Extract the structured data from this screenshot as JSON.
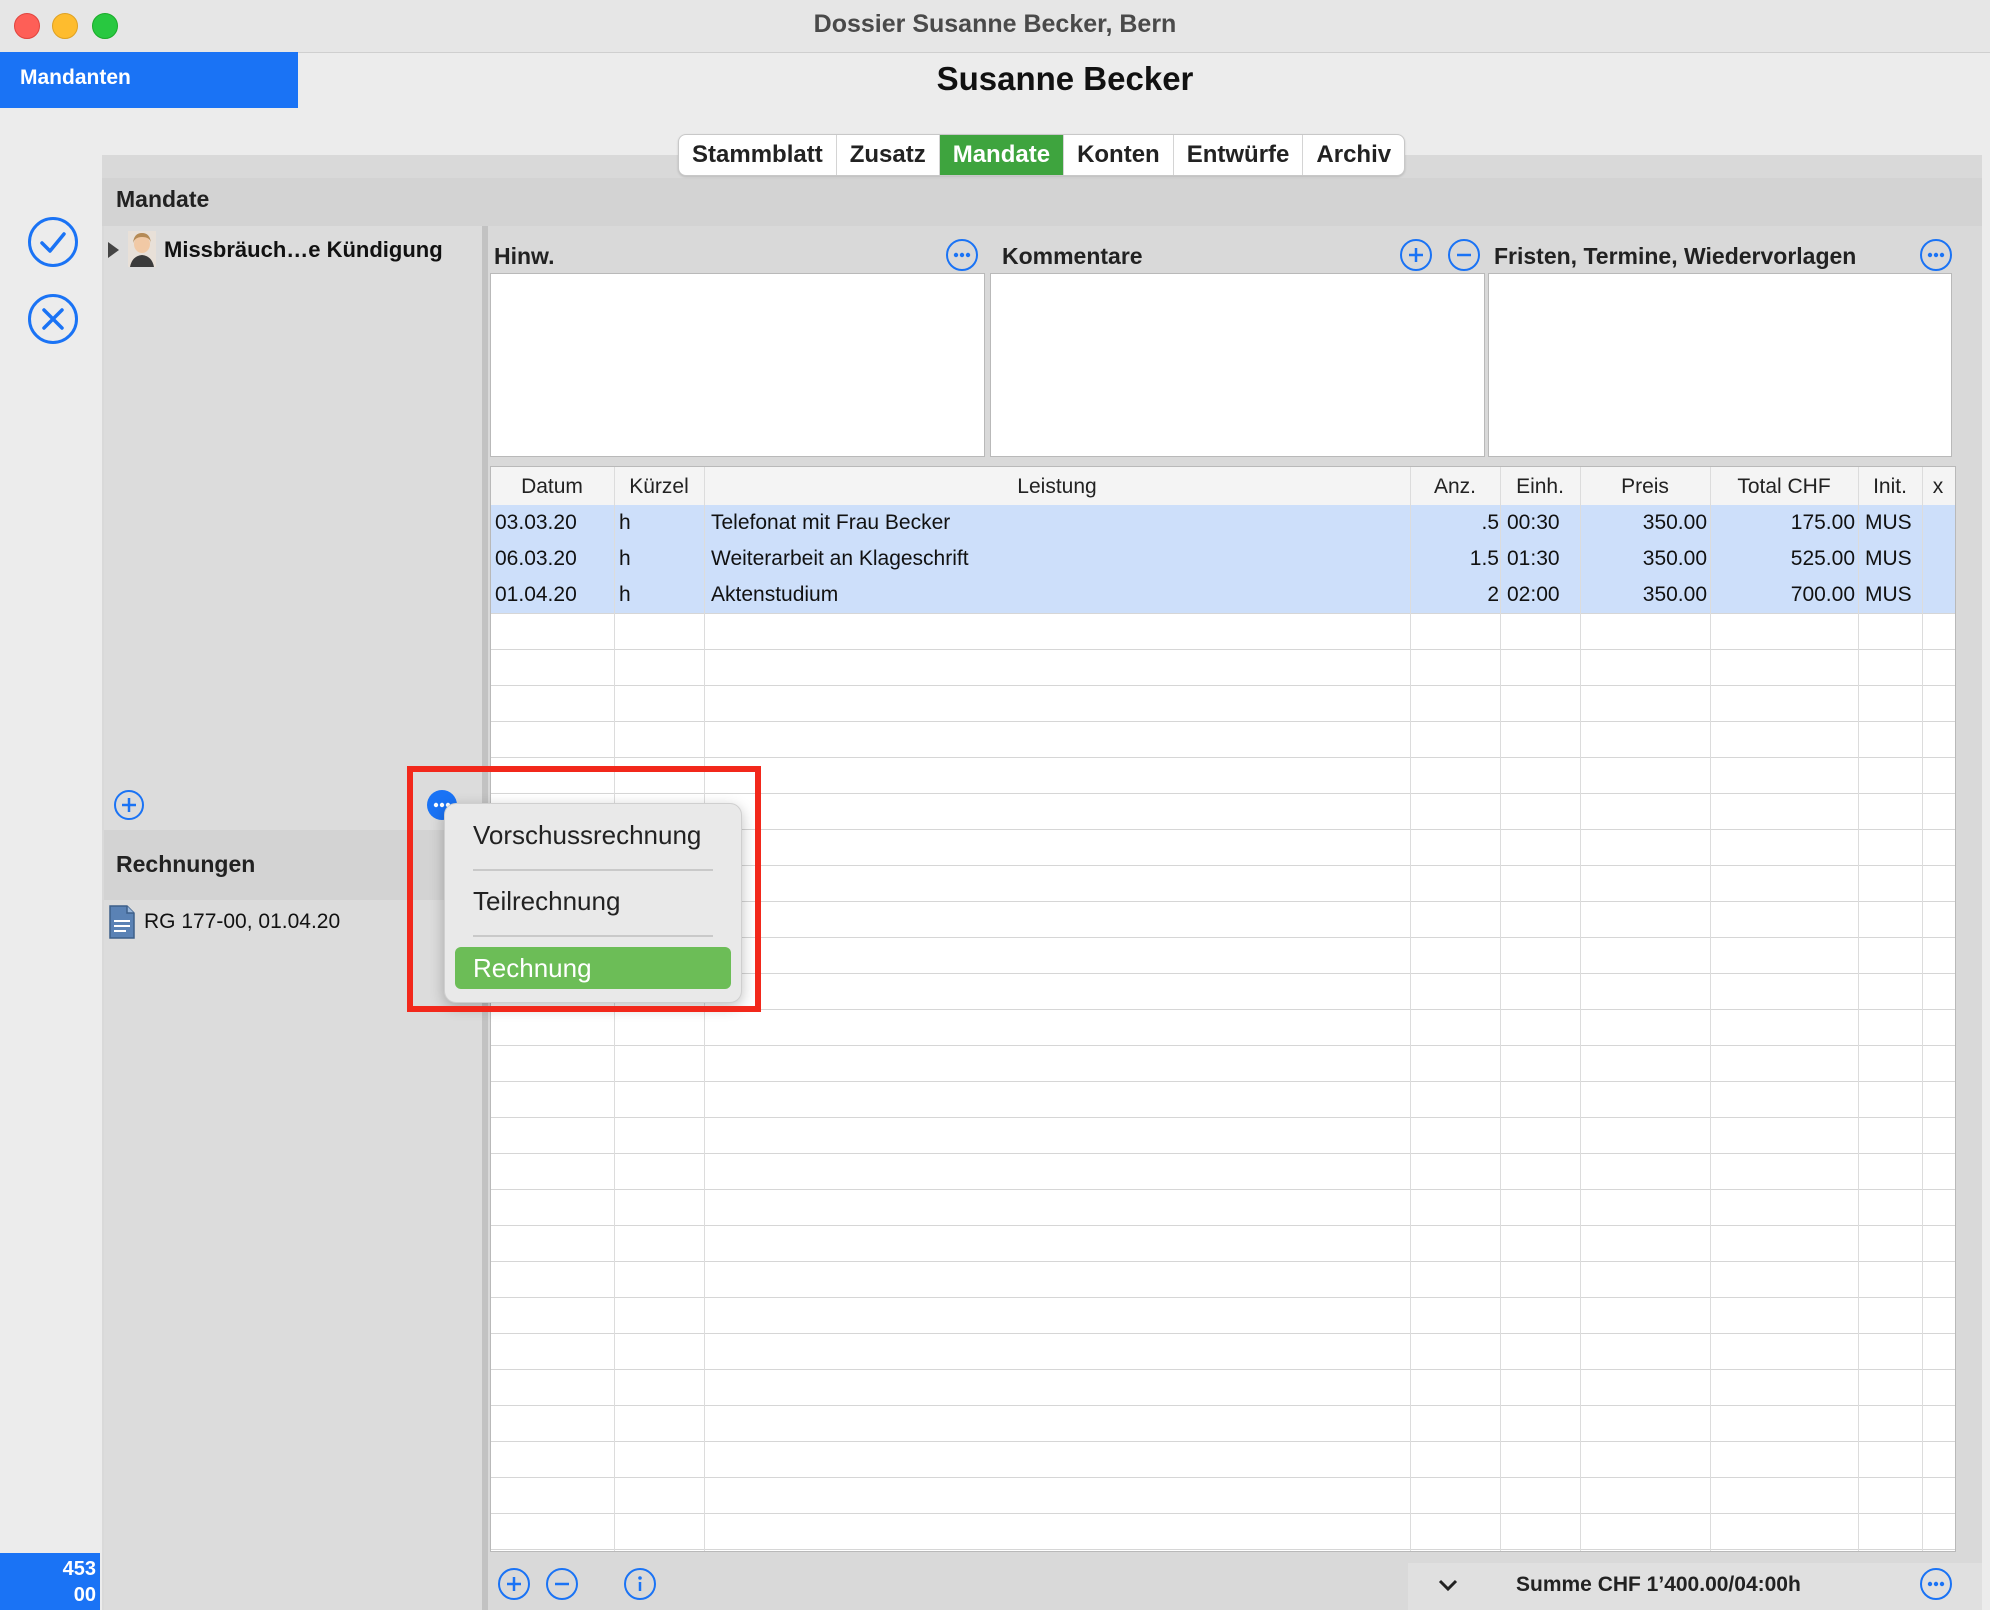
{
  "window": {
    "title": "Dossier Susanne Becker, Bern"
  },
  "sidebar": {
    "mandanten_label": "Mandanten"
  },
  "client": {
    "name": "Susanne Becker"
  },
  "tabs": [
    "Stammblatt",
    "Zusatz",
    "Mandate",
    "Konten",
    "Entwürfe",
    "Archiv"
  ],
  "active_tab": "Mandate",
  "mandate_section": {
    "title": "Mandate",
    "items": [
      {
        "label": "Missbräuch…e Kündigung"
      }
    ]
  },
  "notes": {
    "hinweise": "Hinw.",
    "kommentare": "Kommentare",
    "fristen": "Fristen, Termine, Wiedervorlagen"
  },
  "table": {
    "headers": [
      "Datum",
      "Kürzel",
      "Leistung",
      "Anz.",
      "Einh.",
      "Preis",
      "Total CHF",
      "Init.",
      "x"
    ],
    "rows": [
      {
        "datum": "03.03.20",
        "kuerzel": "h",
        "leistung": "Telefonat mit Frau Becker",
        "anz": ".5",
        "einh": "00:30",
        "preis": "350.00",
        "total": "175.00",
        "init": "MUS"
      },
      {
        "datum": "06.03.20",
        "kuerzel": "h",
        "leistung": "Weiterarbeit an Klageschrift",
        "anz": "1.5",
        "einh": "01:30",
        "preis": "350.00",
        "total": "525.00",
        "init": "MUS"
      },
      {
        "datum": "01.04.20",
        "kuerzel": "h",
        "leistung": "Aktenstudium",
        "anz": "2",
        "einh": "02:00",
        "preis": "350.00",
        "total": "700.00",
        "init": "MUS"
      }
    ]
  },
  "rechnungen": {
    "title": "Rechnungen",
    "items": [
      {
        "label": "RG 177-00, 01.04.20"
      }
    ]
  },
  "popup_menu": {
    "items": [
      "Vorschussrechnung",
      "Teilrechnung",
      "Rechnung"
    ],
    "highlighted": "Rechnung"
  },
  "footer": {
    "summe": "Summe CHF 1’400.00/04:00h"
  },
  "status_badge": {
    "line1": "453",
    "line2": "00"
  },
  "colors": {
    "accent": "#1a73f5",
    "active_tab": "#3ea43e",
    "menu_highlight": "#6cbd57",
    "annotation": "#f2281b",
    "selection": "#cddffa"
  },
  "icons": [
    "confirm-check-icon",
    "cancel-x-icon",
    "add-icon",
    "remove-icon",
    "more-icon",
    "info-icon",
    "chevron-down-icon",
    "disclosure-triangle-icon",
    "avatar-icon",
    "document-icon"
  ]
}
